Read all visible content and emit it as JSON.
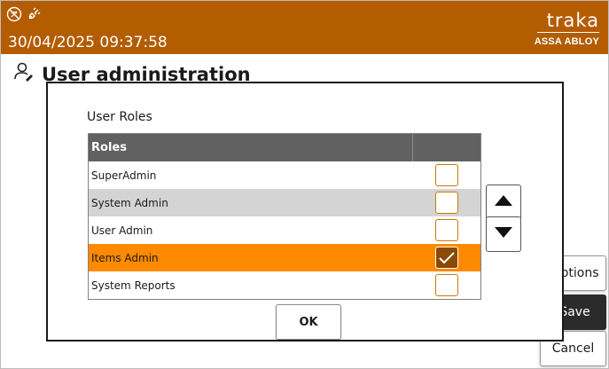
{
  "header": {
    "datetime": "30/04/2025 09:37:58",
    "brand_name": "traka",
    "brand_sub": "ASSA ABLOY",
    "status_icons": [
      "no-network-icon",
      "unplugged-icon"
    ]
  },
  "page": {
    "title": "User administration",
    "icon": "user-edit-icon"
  },
  "background_buttons": {
    "options_label": "Options",
    "save_label": "Save",
    "cancel_label": "Cancel"
  },
  "modal": {
    "title": "User Roles",
    "table": {
      "header": "Roles",
      "rows": [
        {
          "name": "SuperAdmin",
          "checked": false,
          "selected": false
        },
        {
          "name": "System Admin",
          "checked": false,
          "selected": false
        },
        {
          "name": "User Admin",
          "checked": false,
          "selected": false
        },
        {
          "name": "Items Admin",
          "checked": true,
          "selected": true
        },
        {
          "name": "System Reports",
          "checked": false,
          "selected": false
        }
      ]
    },
    "ok_label": "OK",
    "arrow_up_icon": "triangle-up-icon",
    "arrow_down_icon": "triangle-down-icon"
  },
  "colors": {
    "header": "#b35c00",
    "selected_row": "#ff8a00",
    "checkbox_border": "#c97a00",
    "checkbox_checked": "#8a4a00"
  }
}
